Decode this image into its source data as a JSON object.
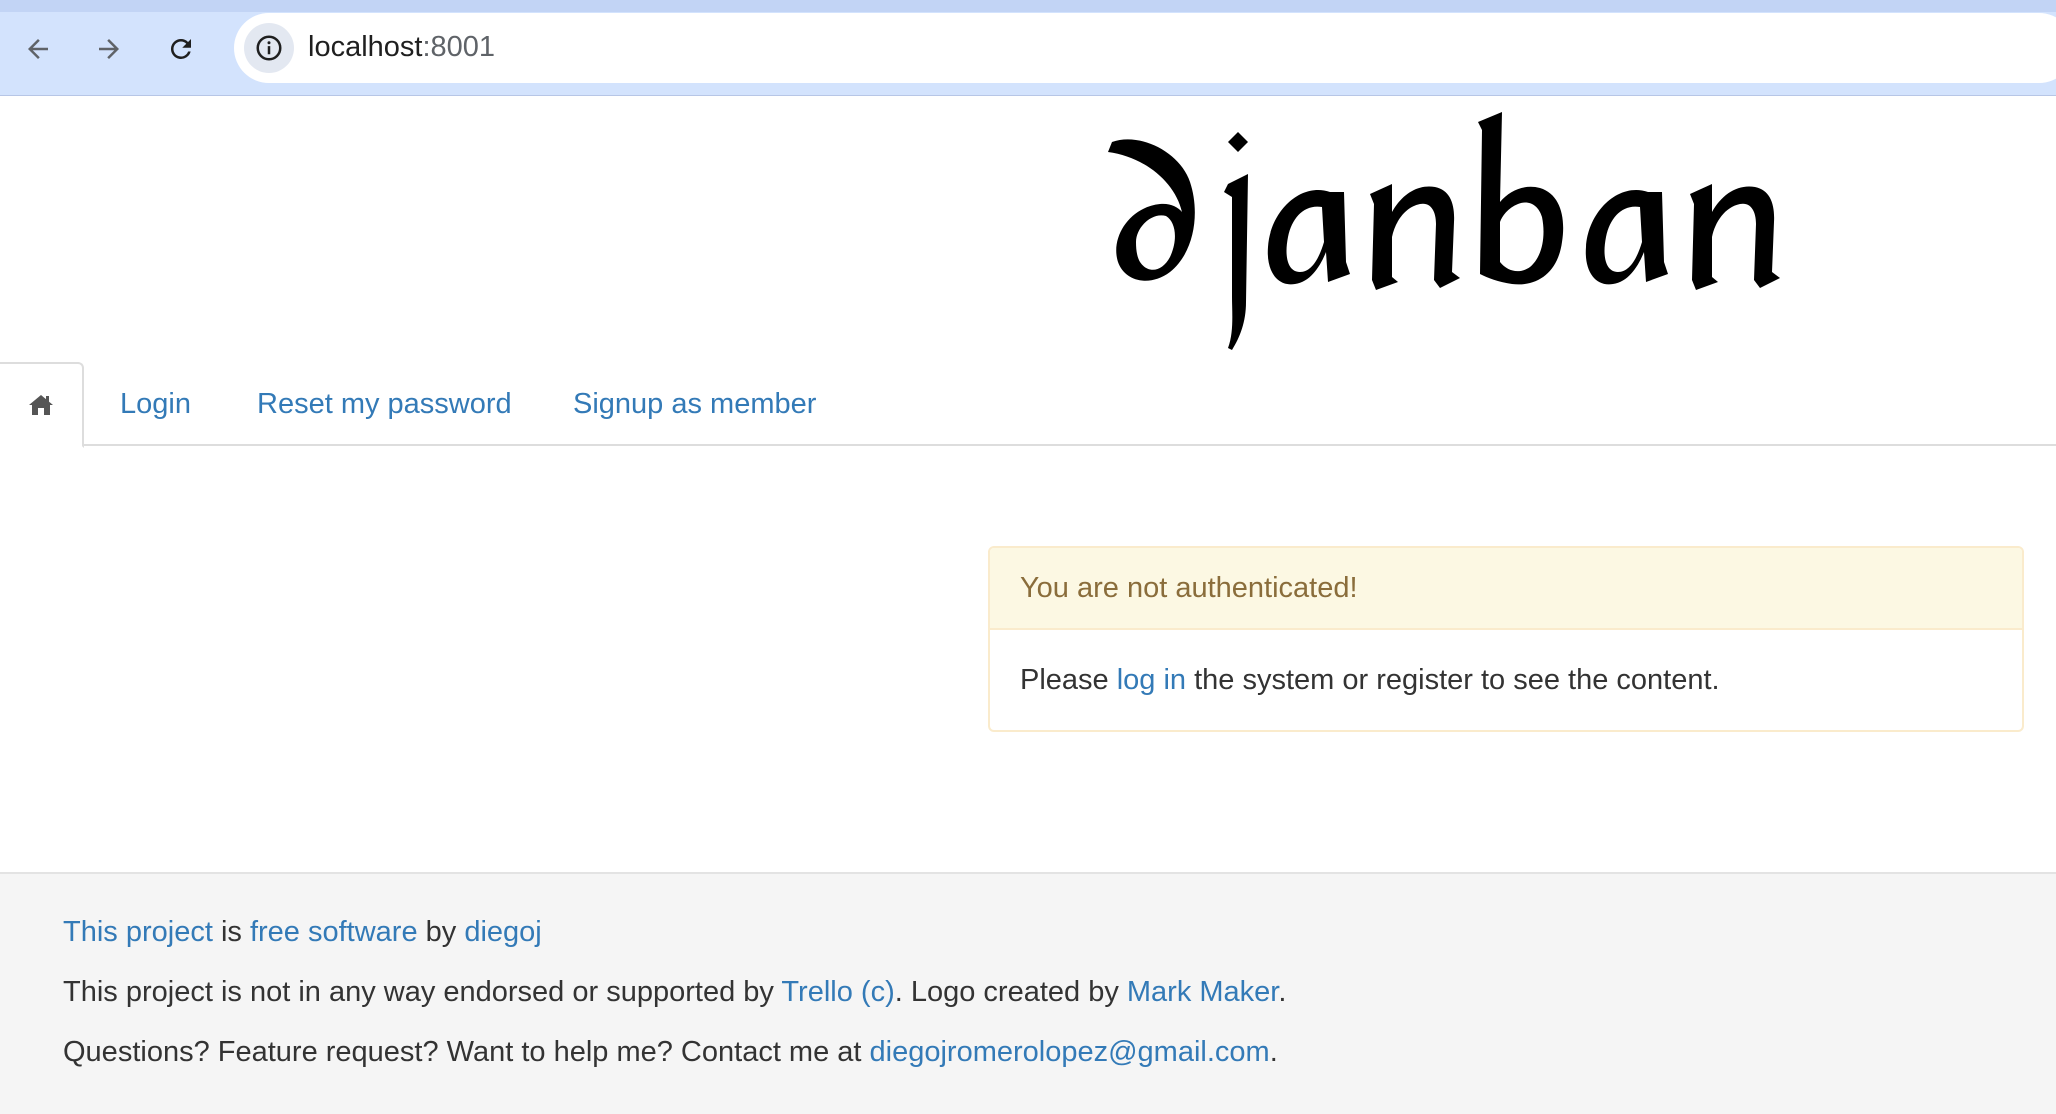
{
  "browser": {
    "url_host": "localhost",
    "url_port": ":8001",
    "icons": {
      "back": "arrow-left-icon",
      "forward": "arrow-right-icon",
      "reload": "reload-icon",
      "site_info": "info-icon"
    }
  },
  "header": {
    "logo_text": "djanban"
  },
  "tabs": {
    "home_icon": "home-icon",
    "items": [
      {
        "label": "Login"
      },
      {
        "label": "Reset my password"
      },
      {
        "label": "Signup as member"
      }
    ]
  },
  "panel": {
    "heading": "You are not authenticated!",
    "body_prefix": "Please ",
    "body_link": "log in",
    "body_suffix": " the system or register to see the content."
  },
  "footer": {
    "line1": {
      "link1": "This project",
      "text1": " is ",
      "link2": "free software",
      "text2": " by ",
      "link3": "diegoj"
    },
    "line2": {
      "text1": "This project is not in any way endorsed or supported by ",
      "link1": "Trello (c)",
      "text2": ". Logo created by ",
      "link2": "Mark Maker",
      "text3": "."
    },
    "line3": {
      "text1": "Questions? Feature request? Want to help me? Contact me at ",
      "link1": "diegojromerolopez@gmail.com",
      "text2": "."
    }
  },
  "colors": {
    "link": "#337ab7",
    "warning_bg": "#fcf8e3",
    "warning_border": "#faebcc",
    "warning_text": "#8a6d3b",
    "chrome_bg": "#d3e3fd",
    "footer_bg": "#f5f5f5"
  }
}
